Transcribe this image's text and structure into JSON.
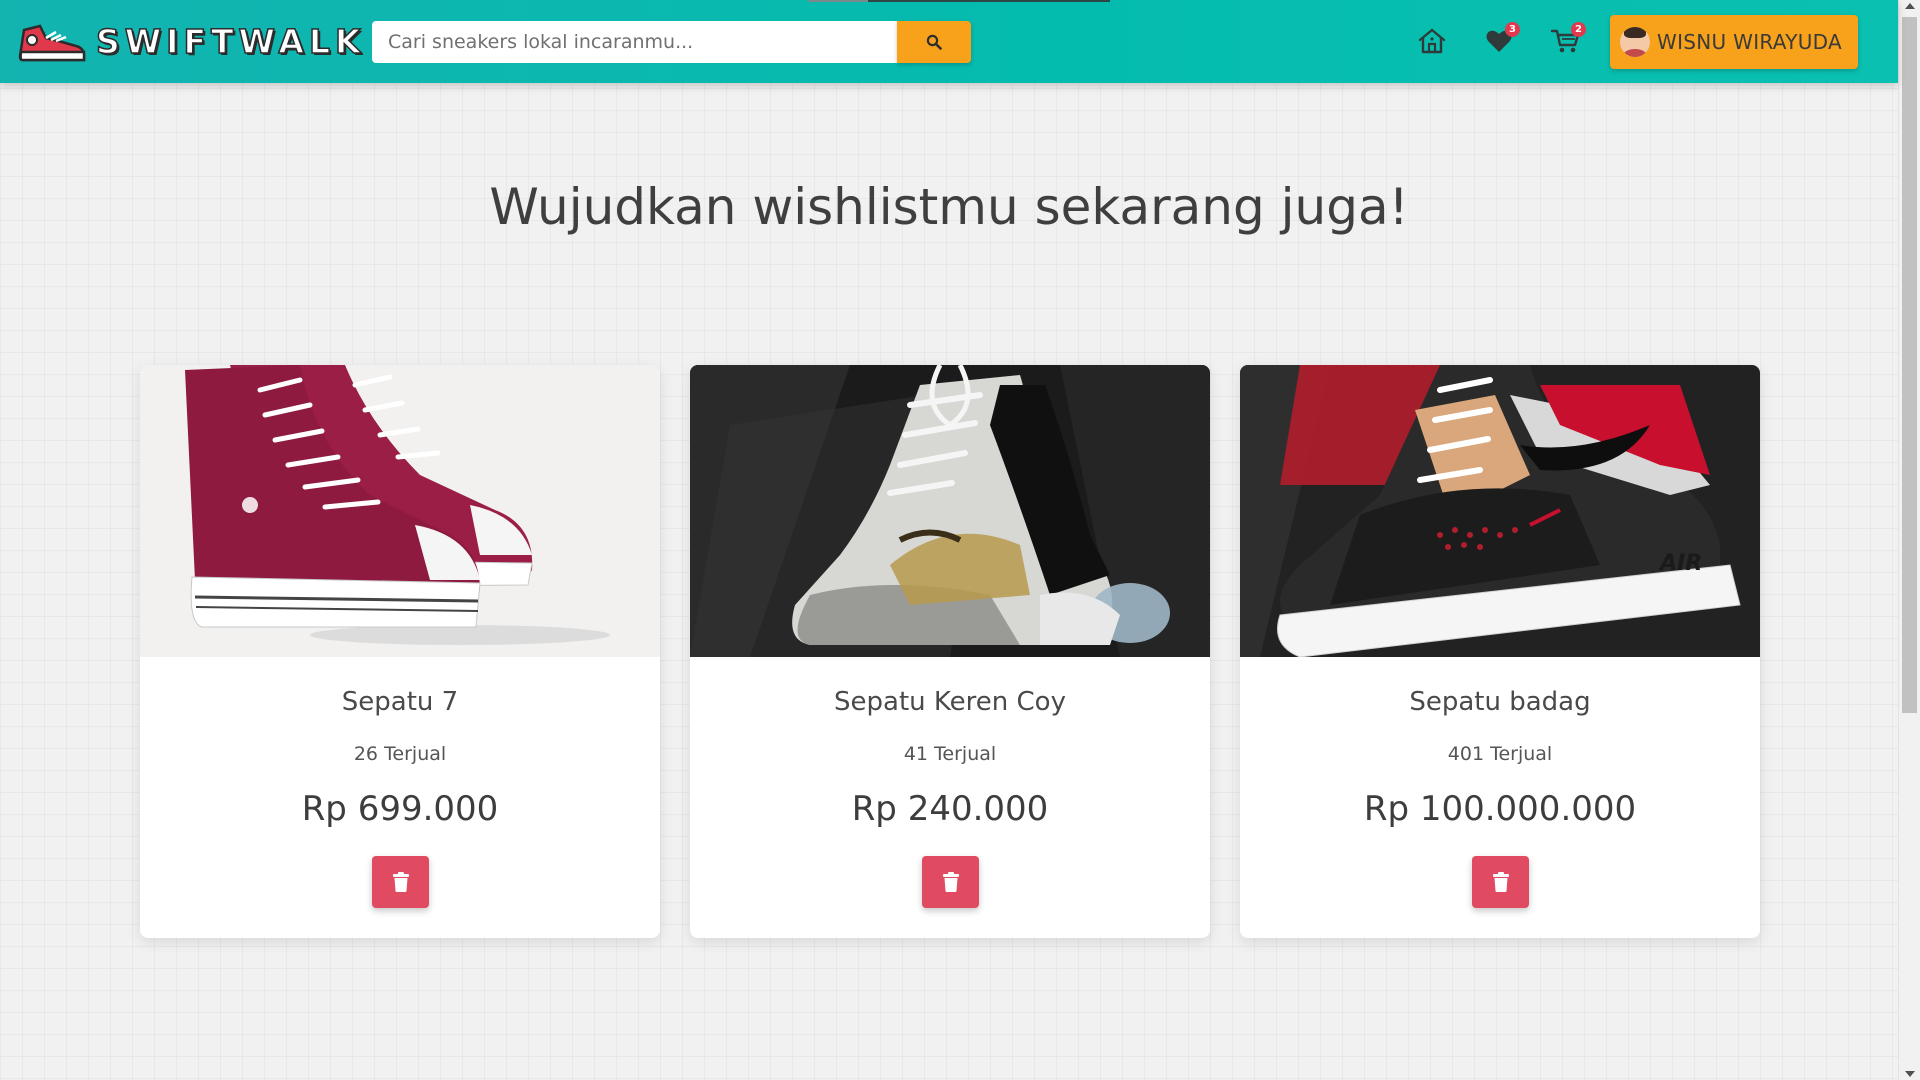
{
  "navbar": {
    "brand": "SWIFTWALK",
    "search_placeholder": "Cari sneakers lokal incaranmu...",
    "wishlist_count": "3",
    "cart_count": "2",
    "user_name": "WISNU WIRAYUDA"
  },
  "icons": {
    "logo": "sneaker-logo-icon",
    "search": "search-icon",
    "home": "home-icon",
    "wishlist": "heart-icon",
    "cart": "cart-icon",
    "delete": "trash-icon"
  },
  "colors": {
    "navbar": "#04bcae",
    "accent": "#f7a21a",
    "delete": "#e04b62",
    "badge": "#e2394f"
  },
  "page": {
    "title": "Wujudkan wishlistmu sekarang juga!"
  },
  "products": [
    {
      "name": "Sepatu 7",
      "sold": "26 Terjual",
      "price": "Rp 699.000"
    },
    {
      "name": "Sepatu Keren Coy",
      "sold": "41 Terjual",
      "price": "Rp 240.000"
    },
    {
      "name": "Sepatu badag",
      "sold": "401 Terjual",
      "price": "Rp 100.000.000"
    }
  ]
}
